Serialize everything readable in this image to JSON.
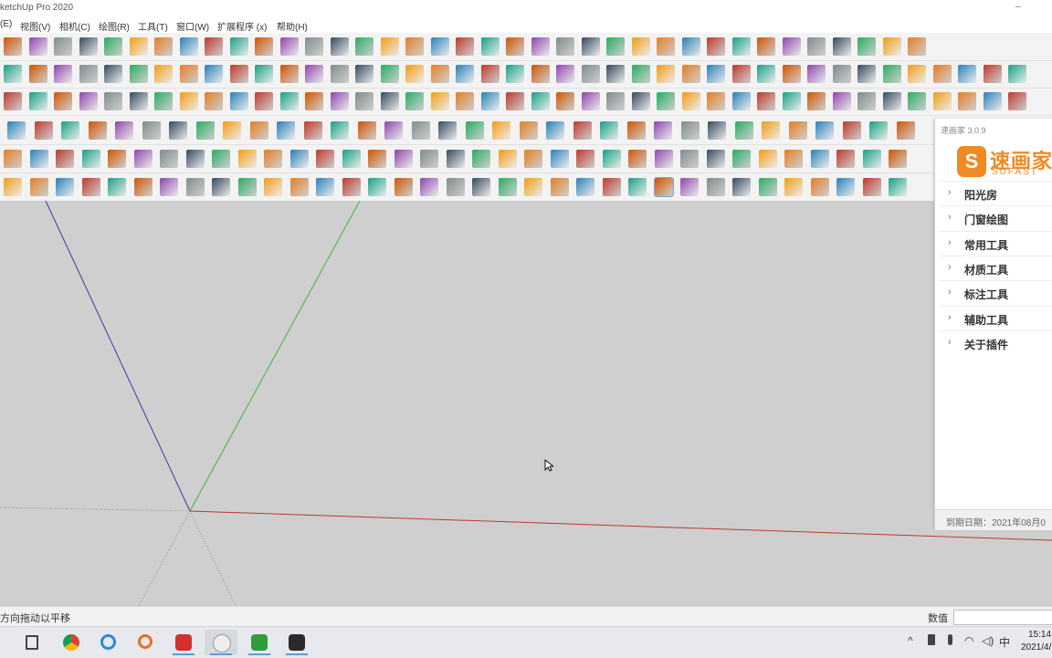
{
  "window": {
    "title": "ketchUp Pro 2020",
    "minimize_glyph": "–"
  },
  "menu": {
    "items": [
      "(E)",
      "视图(V)",
      "相机(C)",
      "绘图(R)",
      "工具(T)",
      "窗口(W)",
      "扩展程序 (x)",
      "帮助(H)"
    ]
  },
  "toolbars": {
    "selected_tool": "paint-bucket-icon"
  },
  "plugin_panel": {
    "title": "速画家 3.0.9",
    "logo_mark": "S",
    "logo_text": "速画家",
    "logo_sub": "SUFAST",
    "items": [
      "阳光房",
      "门窗绘图",
      "常用工具",
      "材质工具",
      "标注工具",
      "辅助工具",
      "关于插件"
    ],
    "expiry": "到期日期：2021年08月0"
  },
  "statusbar": {
    "hint": "方向拖动以平移",
    "value_label": "数值",
    "value": ""
  },
  "taskbar": {
    "apps": [
      "start-icon",
      "chrome-icon",
      "search-icon",
      "magnifier-icon",
      "sketchup-icon",
      "chicken-icon",
      "camtasia-icon",
      "capture-icon"
    ],
    "ime": "中",
    "time": "15:14",
    "date": "2021/4/"
  },
  "colors": {
    "axis_red": "#c0392b",
    "axis_green": "#3fb33f",
    "axis_blue": "#3a3aa8",
    "canvas": "#cfcfcf",
    "accent": "#f08a24"
  }
}
